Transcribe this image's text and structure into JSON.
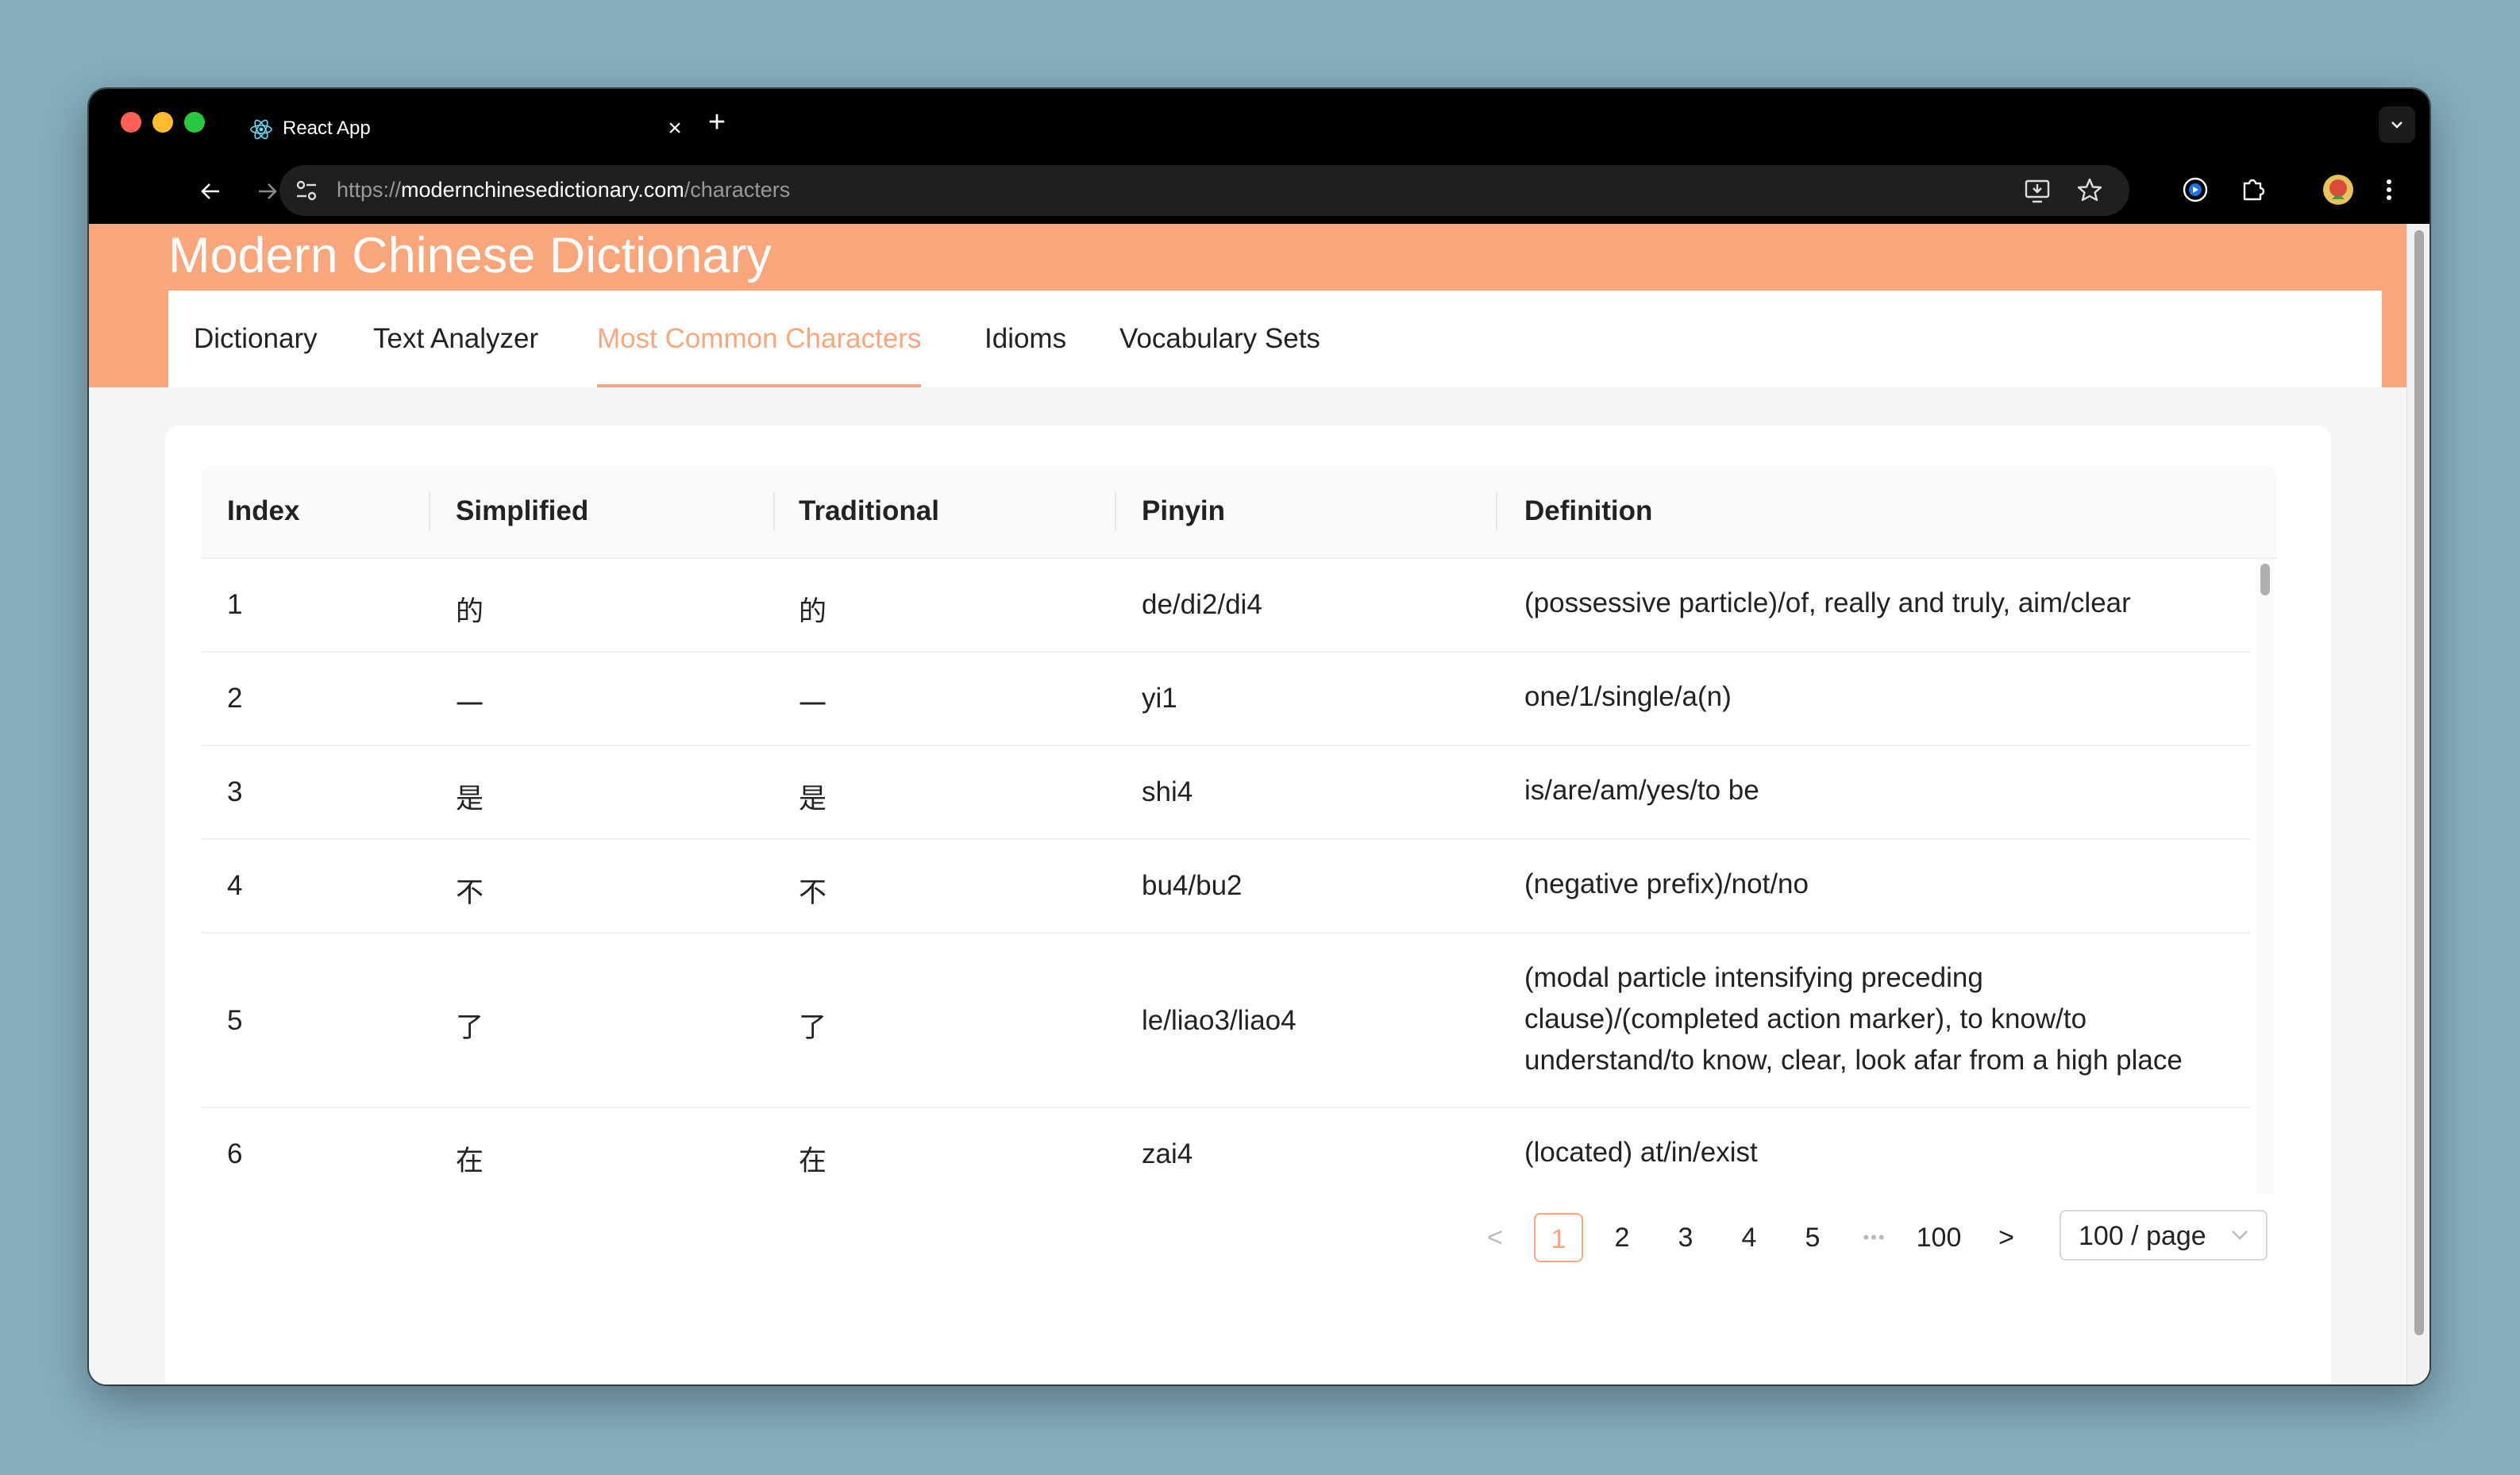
{
  "browser": {
    "tab_title": "React App",
    "url_prefix": "https://",
    "url_domain": "modernchinesedictionary.com",
    "url_path": "/characters"
  },
  "site": {
    "title": "Modern Chinese Dictionary",
    "nav": [
      {
        "label": "Dictionary"
      },
      {
        "label": "Text Analyzer"
      },
      {
        "label": "Most Common Characters",
        "active": true
      },
      {
        "label": "Idioms"
      },
      {
        "label": "Vocabulary Sets"
      }
    ]
  },
  "table": {
    "columns": [
      "Index",
      "Simplified",
      "Traditional",
      "Pinyin",
      "Definition"
    ],
    "rows": [
      {
        "index": "1",
        "simplified": "的",
        "traditional": "的",
        "pinyin": "de/di2/di4",
        "definition": "(possessive particle)/of, really and truly, aim/clear"
      },
      {
        "index": "2",
        "simplified": "一",
        "traditional": "一",
        "pinyin": "yi1",
        "definition": "one/1/single/a(n)"
      },
      {
        "index": "3",
        "simplified": "是",
        "traditional": "是",
        "pinyin": "shi4",
        "definition": "is/are/am/yes/to be"
      },
      {
        "index": "4",
        "simplified": "不",
        "traditional": "不",
        "pinyin": "bu4/bu2",
        "definition": "(negative prefix)/not/no"
      },
      {
        "index": "5",
        "simplified": "了",
        "traditional": "了",
        "pinyin": "le/liao3/liao4",
        "definition": "(modal particle intensifying preceding clause)/(completed action marker), to know/to understand/to know, clear, look afar from a high place"
      },
      {
        "index": "6",
        "simplified": "在",
        "traditional": "在",
        "pinyin": "zai4",
        "definition": "(located) at/in/exist"
      }
    ]
  },
  "pagination": {
    "prev": "<",
    "pages": [
      "1",
      "2",
      "3",
      "4",
      "5"
    ],
    "ellipsis": "•••",
    "last": "100",
    "next": ">",
    "current": "1",
    "page_size": "100 / page"
  }
}
